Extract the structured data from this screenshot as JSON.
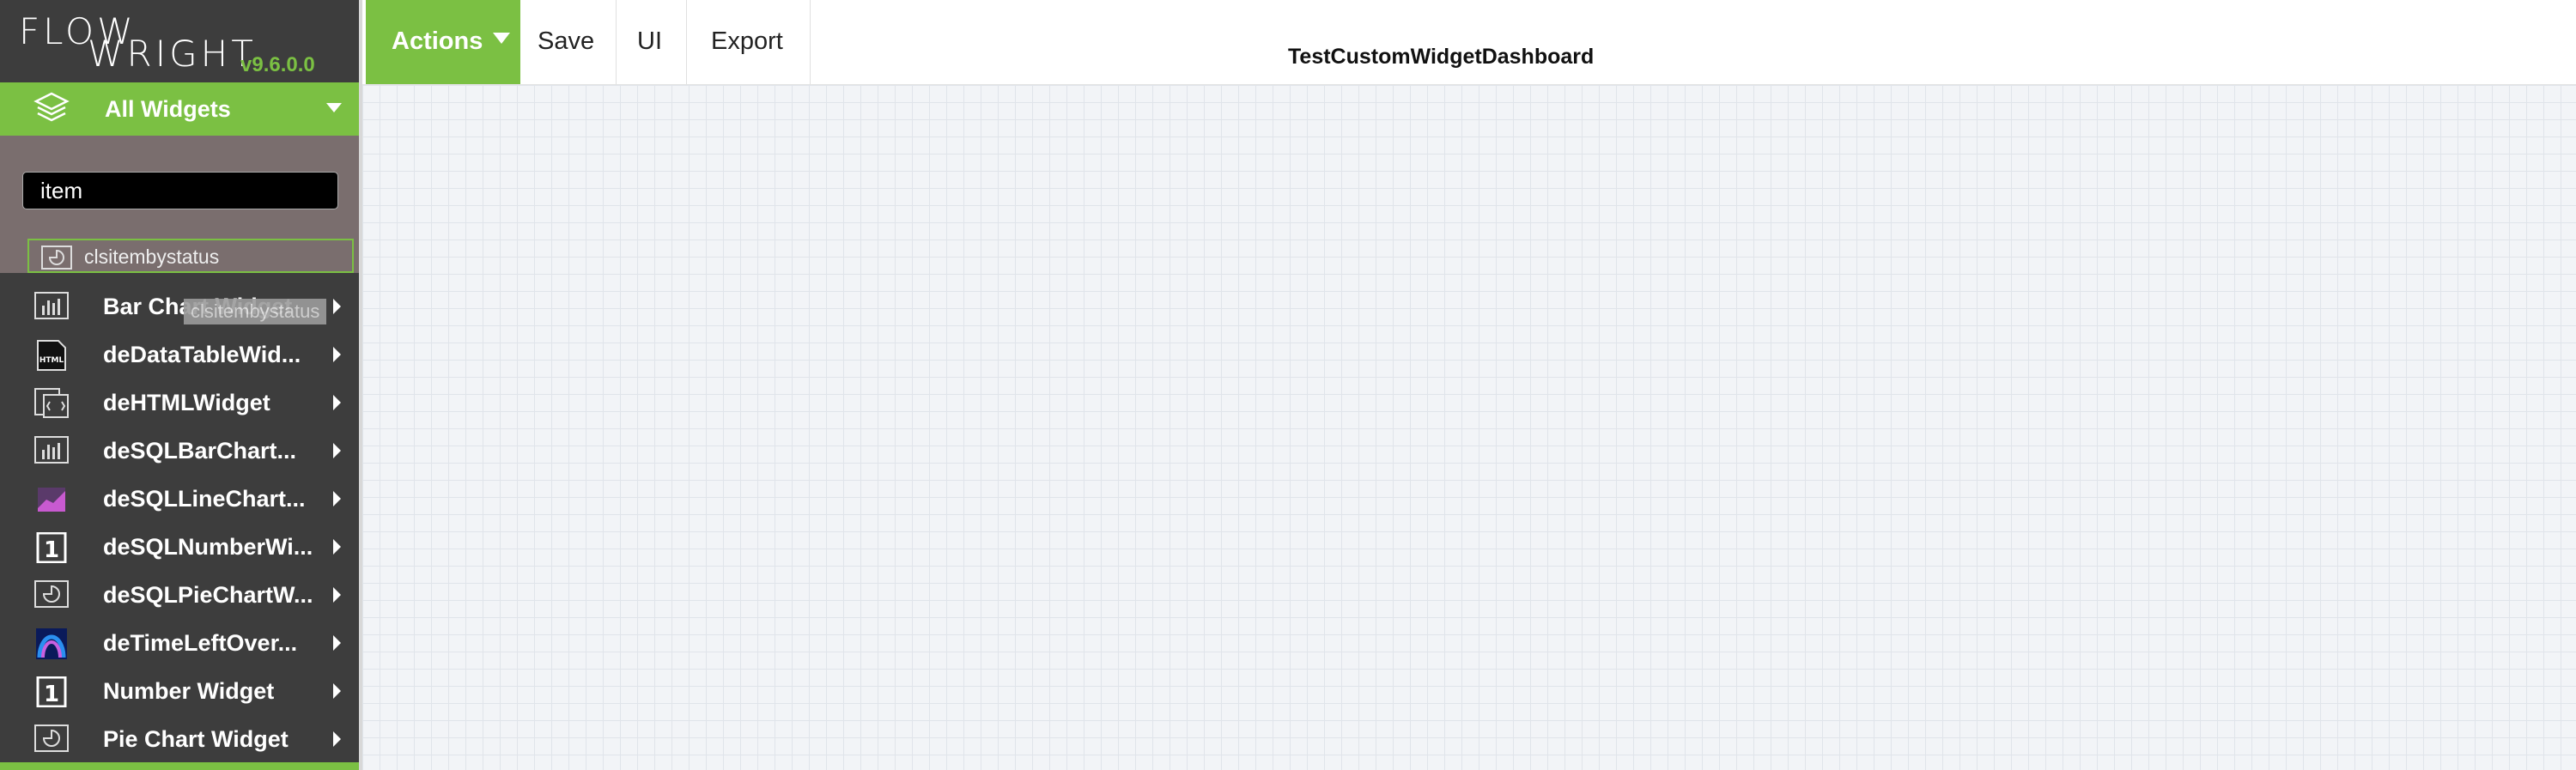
{
  "logo": {
    "line1": "FLOW",
    "line2": "WRIGHT",
    "version": "v9.6.0.0"
  },
  "sidebar": {
    "category_label": "All Widgets",
    "search": {
      "value": "item",
      "placeholder": ""
    },
    "search_result": {
      "label": "clsitembystatus",
      "icon": "pie-chart-icon"
    },
    "tooltip": "clsitembystatus",
    "items": [
      {
        "label": "Bar Chart Widget",
        "icon": "bar-chart-icon"
      },
      {
        "label": "deDataTableWid...",
        "icon": "html-file-icon"
      },
      {
        "label": "deHTMLWidget",
        "icon": "html-code-icon"
      },
      {
        "label": "deSQLBarChart...",
        "icon": "bar-chart-icon"
      },
      {
        "label": "deSQLLineChart...",
        "icon": "line-chart-icon"
      },
      {
        "label": "deSQLNumberWi...",
        "icon": "number-one-icon"
      },
      {
        "label": "deSQLPieChartW...",
        "icon": "pie-chart-icon"
      },
      {
        "label": "deTimeLeftOver...",
        "icon": "gauge-icon"
      },
      {
        "label": "Number Widget",
        "icon": "number-one-icon"
      },
      {
        "label": "Pie Chart Widget",
        "icon": "pie-chart-icon"
      }
    ]
  },
  "toolbar": {
    "actions": "Actions",
    "save": "Save",
    "ui": "UI",
    "export": "Export"
  },
  "dashboard": {
    "title": "TestCustomWidgetDashboard"
  },
  "colors": {
    "accent": "#7bc043",
    "sidebar_bg": "#3d3d3d",
    "search_bg": "#7a6e6e"
  }
}
